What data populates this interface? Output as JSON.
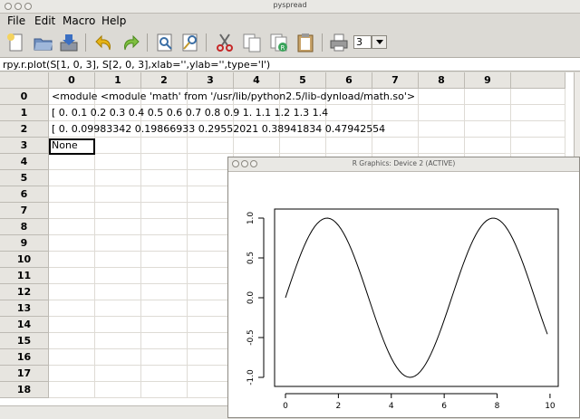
{
  "window": {
    "title": "pyspread"
  },
  "menu": [
    "File",
    "Edit",
    "Macro",
    "Help"
  ],
  "toolbar": {
    "icons": [
      "new-file-icon",
      "open-folder-icon",
      "save-icon",
      "undo-icon",
      "redo-icon",
      "print-preview-icon",
      "find-replace-icon",
      "cut-icon",
      "copy-icon",
      "copy-results-icon",
      "paste-icon",
      "print-icon"
    ],
    "spin_value": "3"
  },
  "formula": "rpy.r.plot(S[1, 0, 3], S[2, 0, 3],xlab='',ylab='',type='l')",
  "grid": {
    "columns": [
      "0",
      "1",
      "2",
      "3",
      "4",
      "5",
      "6",
      "7",
      "8",
      "9"
    ],
    "rows": [
      "0",
      "1",
      "2",
      "3",
      "4",
      "5",
      "6",
      "7",
      "8",
      "9",
      "10",
      "11",
      "12",
      "13",
      "14",
      "15",
      "16",
      "17",
      "18"
    ],
    "cells": [
      {
        "row": "0",
        "text": "<module <module 'math' from '/usr/lib/python2.5/lib-dynload/math.so'>"
      },
      {
        "row": "1",
        "text": "[ 0.   0.1  0.2  0.3  0.4  0.5  0.6  0.7  0.8  0.9  1.   1.1  1.2  1.3  1.4"
      },
      {
        "row": "2",
        "text": "[ 0.          0.09983342  0.19866933  0.29552021  0.38941834  0.47942554"
      },
      {
        "row": "3",
        "text": "None"
      }
    ]
  },
  "rgraphics": {
    "title": "R Graphics: Device 2 (ACTIVE)",
    "chart_data": {
      "type": "line",
      "x_ticks": [
        "0",
        "2",
        "4",
        "6",
        "8",
        "10"
      ],
      "y_ticks": [
        "-1.0",
        "-0.5",
        "0.0",
        "0.5",
        "1.0"
      ],
      "xlabel": "",
      "ylabel": "",
      "xlim": [
        0,
        9.9
      ],
      "ylim": [
        -1.0,
        1.0
      ],
      "x_start": 0,
      "x_end": 9.9,
      "x_step": 0.1,
      "function": "sin"
    }
  }
}
